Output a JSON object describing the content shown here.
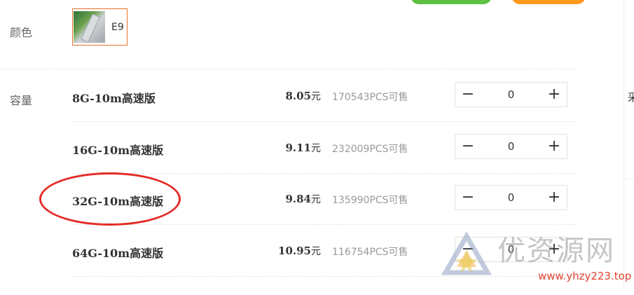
{
  "top_buttons": {
    "green": "",
    "orange": ""
  },
  "color": {
    "label": "颜色",
    "option": {
      "text": "E9",
      "thumb_icon": "usb-drive-thumbnail",
      "border_color": "#e8712b"
    }
  },
  "capacity": {
    "label": "容量",
    "rows": [
      {
        "name": "8G-10m高速版",
        "price": "8.05",
        "unit": "元",
        "stock": "170543PCS可售",
        "qty": "0"
      },
      {
        "name": "16G-10m高速版",
        "price": "9.11",
        "unit": "元",
        "stock": "232009PCS可售",
        "qty": "0"
      },
      {
        "name": "32G-10m高速版",
        "price": "9.84",
        "unit": "元",
        "stock": "135990PCS可售",
        "qty": "0"
      },
      {
        "name": "64G-10m高速版",
        "price": "10.95",
        "unit": "元",
        "stock": "116754PCS可售",
        "qty": "0"
      }
    ],
    "minus_symbol": "−",
    "plus_symbol": "+"
  },
  "annotation": {
    "color": "#e32b25"
  },
  "right_panel": {
    "partial_char": "采"
  },
  "watermark": {
    "text": "优资源网",
    "url": "www.yhzy223.top",
    "logo_icon": "triangle-logo-icon"
  }
}
